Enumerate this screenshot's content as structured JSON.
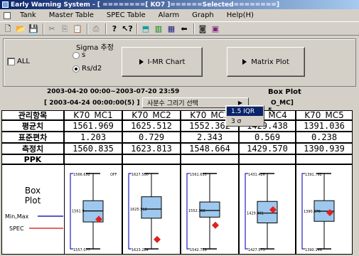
{
  "window": {
    "title": "Early Warning System - [ ========[ KO7 ]======Selected========]"
  },
  "menu": {
    "items": [
      "Tank",
      "Master Table",
      "SPEC Table",
      "Alarm",
      "Graph",
      "Help(H)"
    ]
  },
  "toolbar": {
    "icons": [
      "new-icon",
      "open-icon",
      "save-icon",
      "cut-icon",
      "copy-icon",
      "paste-icon",
      "print-icon",
      "help-icon",
      "context-help-icon",
      "tank-icon",
      "chart-icon",
      "table-icon",
      "back-icon",
      "camera-icon",
      "image-icon"
    ]
  },
  "controls": {
    "all_label": "ALL",
    "sigma_label": "Sigma 추정",
    "sigma_options": [
      "s",
      "Rs/d2"
    ],
    "sigma_selected": "Rs/d2",
    "imr_button": "I-MR Chart",
    "matrix_button": "Matrix Plot"
  },
  "info": {
    "date_range": "2003-04-20 00:00~2003-07-20 23:59",
    "plot_title": "Box Plot",
    "sub_range": "[ 2003-04-24 00:00:00(5) ]",
    "sub_tail": "O_MC]"
  },
  "context_menu": {
    "main_label": "사분수 그리기 선택",
    "options": [
      "1.5 IQR",
      "3 σ"
    ],
    "highlighted": "1.5 IQR"
  },
  "table": {
    "corner": "관리항목",
    "row_labels": [
      "평균치",
      "표준편차",
      "측정치",
      "PPK"
    ],
    "columns": [
      {
        "name": "K70_MC1",
        "mean": "1561.969",
        "std": "1.203",
        "measured": "1560.835",
        "ppk": "",
        "top": "1566.652",
        "bottom": "1557.077",
        "mid": "1561.9",
        "extra": "OFF"
      },
      {
        "name": "K70_MC2",
        "mean": "1625.512",
        "std": "0.729",
        "measured": "1623.813",
        "ppk": "",
        "top": "1627.500",
        "bottom": "1623.284",
        "mid": "1625.512"
      },
      {
        "name": "K70_MC3",
        "mean": "1552.362",
        "std": "2.343",
        "measured": "1548.664",
        "ppk": "",
        "top": "1561.635",
        "bottom": "1542.739",
        "mid": "1552.362"
      },
      {
        "name": "K70_MC4",
        "mean": "1429.438",
        "std": "0.569",
        "measured": "1429.570",
        "ppk": "",
        "top": "1431.426",
        "bottom": "1427.573",
        "mid": "1429.401"
      },
      {
        "name": "K70_MC5",
        "mean": "1391.036",
        "std": "0.238",
        "measured": "1390.939",
        "ppk": "",
        "top": "1391.792",
        "bottom": "1390.149",
        "mid": "1390.970"
      }
    ]
  },
  "legend": {
    "box_label": "Box\nPlot",
    "minmax_label": "Min,Max",
    "spec_label": "SPEC"
  },
  "colors": {
    "spec_line": "#e03030",
    "minmax_line": "#2020c0",
    "box_fill": "#9ec8ee",
    "point": "#e02020"
  },
  "chart_data": {
    "type": "box",
    "categories": [
      "K70_MC1",
      "K70_MC2",
      "K70_MC3",
      "K70_MC4",
      "K70_MC5"
    ],
    "series": [
      {
        "name": "K70_MC1",
        "min": 1557.077,
        "q1": 1560.5,
        "median": 1561.9,
        "q3": 1563.2,
        "max": 1566.652,
        "point": 1560.835
      },
      {
        "name": "K70_MC2",
        "min": 1623.284,
        "q1": 1625.0,
        "median": 1625.512,
        "q3": 1626.2,
        "max": 1627.5,
        "point": 1623.813
      },
      {
        "name": "K70_MC3",
        "min": 1542.739,
        "q1": 1550.7,
        "median": 1552.362,
        "q3": 1554.5,
        "max": 1561.635,
        "point": 1548.664
      },
      {
        "name": "K70_MC4",
        "min": 1427.573,
        "q1": 1428.9,
        "median": 1429.401,
        "q3": 1430.0,
        "max": 1431.426,
        "point": 1429.57
      },
      {
        "name": "K70_MC5",
        "min": 1390.149,
        "q1": 1390.75,
        "median": 1390.97,
        "q3": 1391.2,
        "max": 1391.792,
        "point": 1390.939
      }
    ]
  }
}
